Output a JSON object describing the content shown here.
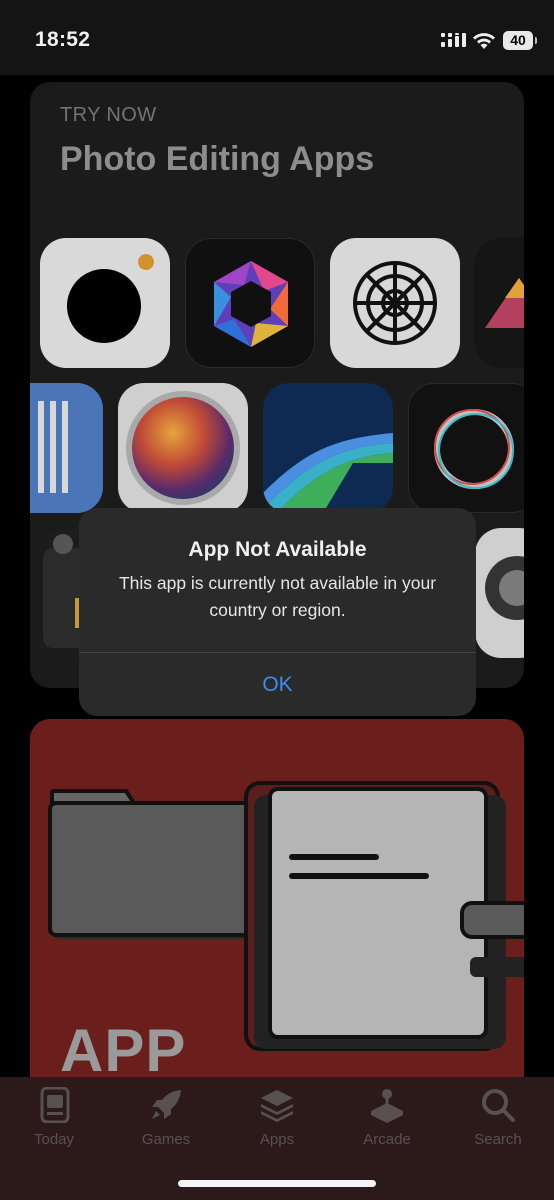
{
  "status_bar": {
    "time": "18:52",
    "battery": "40"
  },
  "card": {
    "eyebrow": "TRY NOW",
    "title": "Photo Editing Apps",
    "app_icons": [
      "camera-app-icon",
      "aperture-app-icon",
      "vsco-app-icon",
      "triangle-app-icon",
      "lines-app-icon",
      "color-sphere-app-icon",
      "lumafusion-app-icon",
      "ring-app-icon",
      "film-camera-app-icon",
      "lens-app-icon"
    ]
  },
  "card2": {
    "text": "APP"
  },
  "alert": {
    "title": "App Not Available",
    "message": "This app is currently not available in your country or region.",
    "ok_label": "OK",
    "ok_color": "#3f8cf1"
  },
  "tab_bar": {
    "tabs": [
      {
        "label": "Today",
        "icon": "today-icon"
      },
      {
        "label": "Games",
        "icon": "rocket-icon"
      },
      {
        "label": "Apps",
        "icon": "layers-icon"
      },
      {
        "label": "Arcade",
        "icon": "joystick-icon"
      },
      {
        "label": "Search",
        "icon": "search-icon"
      }
    ]
  }
}
